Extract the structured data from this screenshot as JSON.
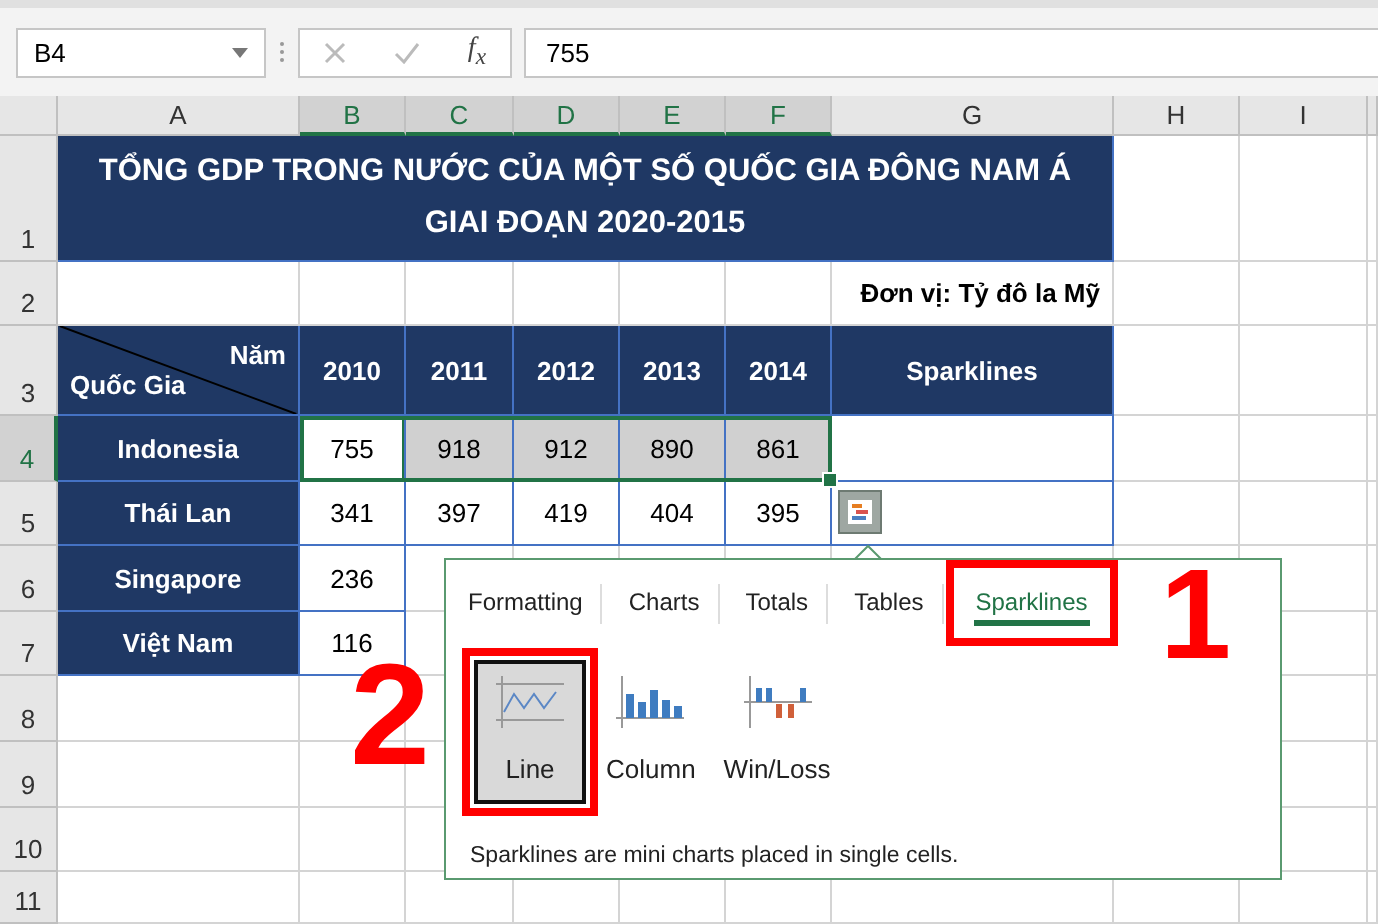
{
  "formula_bar": {
    "name_box": "B4",
    "function_label": "f$_{x}$",
    "formula": "755"
  },
  "columns": [
    {
      "label": "A",
      "selected": false
    },
    {
      "label": "B",
      "selected": true
    },
    {
      "label": "C",
      "selected": true
    },
    {
      "label": "D",
      "selected": true
    },
    {
      "label": "E",
      "selected": true
    },
    {
      "label": "F",
      "selected": true
    },
    {
      "label": "G",
      "selected": false
    },
    {
      "label": "H",
      "selected": false
    },
    {
      "label": "I",
      "selected": false
    }
  ],
  "rows": [
    {
      "label": "1",
      "selected": false
    },
    {
      "label": "2",
      "selected": false
    },
    {
      "label": "3",
      "selected": false
    },
    {
      "label": "4",
      "selected": true
    },
    {
      "label": "5",
      "selected": false
    },
    {
      "label": "6",
      "selected": false
    },
    {
      "label": "7",
      "selected": false
    },
    {
      "label": "8",
      "selected": false
    },
    {
      "label": "9",
      "selected": false
    },
    {
      "label": "10",
      "selected": false
    },
    {
      "label": "11",
      "selected": false
    }
  ],
  "sheet": {
    "title_lines": [
      "TỔNG GDP TRONG NƯỚC CỦA MỘT SỐ QUỐC GIA ĐÔNG NAM Á",
      "GIAI ĐOẠN 2020-2015"
    ],
    "unit": "Đơn vị: Tỷ đô la Mỹ",
    "corner_top": "Năm",
    "corner_bottom": "Quốc Gia",
    "year_headers": [
      "2010",
      "2011",
      "2012",
      "2013",
      "2014"
    ],
    "sparkline_header": "Sparklines",
    "data_rows": [
      {
        "country": "Indonesia",
        "cells": [
          {
            "value": "755",
            "selected": false,
            "active": true
          },
          {
            "value": "918",
            "selected": true,
            "active": false
          },
          {
            "value": "912",
            "selected": true,
            "active": false
          },
          {
            "value": "890",
            "selected": true,
            "active": false
          },
          {
            "value": "861",
            "selected": true,
            "active": false
          }
        ]
      },
      {
        "country": "Thái Lan",
        "cells": [
          {
            "value": "341",
            "selected": false,
            "active": false
          },
          {
            "value": "397",
            "selected": false,
            "active": false
          },
          {
            "value": "419",
            "selected": false,
            "active": false
          },
          {
            "value": "404",
            "selected": false,
            "active": false
          },
          {
            "value": "395",
            "selected": false,
            "active": false
          }
        ]
      },
      {
        "country": "Singapore",
        "cells": [
          {
            "value": "236",
            "selected": false,
            "active": false
          }
        ]
      },
      {
        "country": "Việt Nam",
        "cells": [
          {
            "value": "116",
            "selected": false,
            "active": false
          }
        ]
      }
    ]
  },
  "quick_analysis": {
    "tabs": [
      {
        "label": "Formatting",
        "selected": false
      },
      {
        "label": "Charts",
        "selected": false
      },
      {
        "label": "Totals",
        "selected": false
      },
      {
        "label": "Tables",
        "selected": false
      },
      {
        "label": "Sparklines",
        "selected": true
      }
    ],
    "options": [
      {
        "kind": "line",
        "label": "Line",
        "selected": true
      },
      {
        "kind": "column",
        "label": "Column",
        "selected": false
      },
      {
        "kind": "winloss",
        "label": "Win/Loss",
        "selected": false
      }
    ],
    "description": "Sparklines are mini charts placed in single cells."
  },
  "annotations": [
    {
      "label": "1"
    },
    {
      "label": "2"
    }
  ]
}
